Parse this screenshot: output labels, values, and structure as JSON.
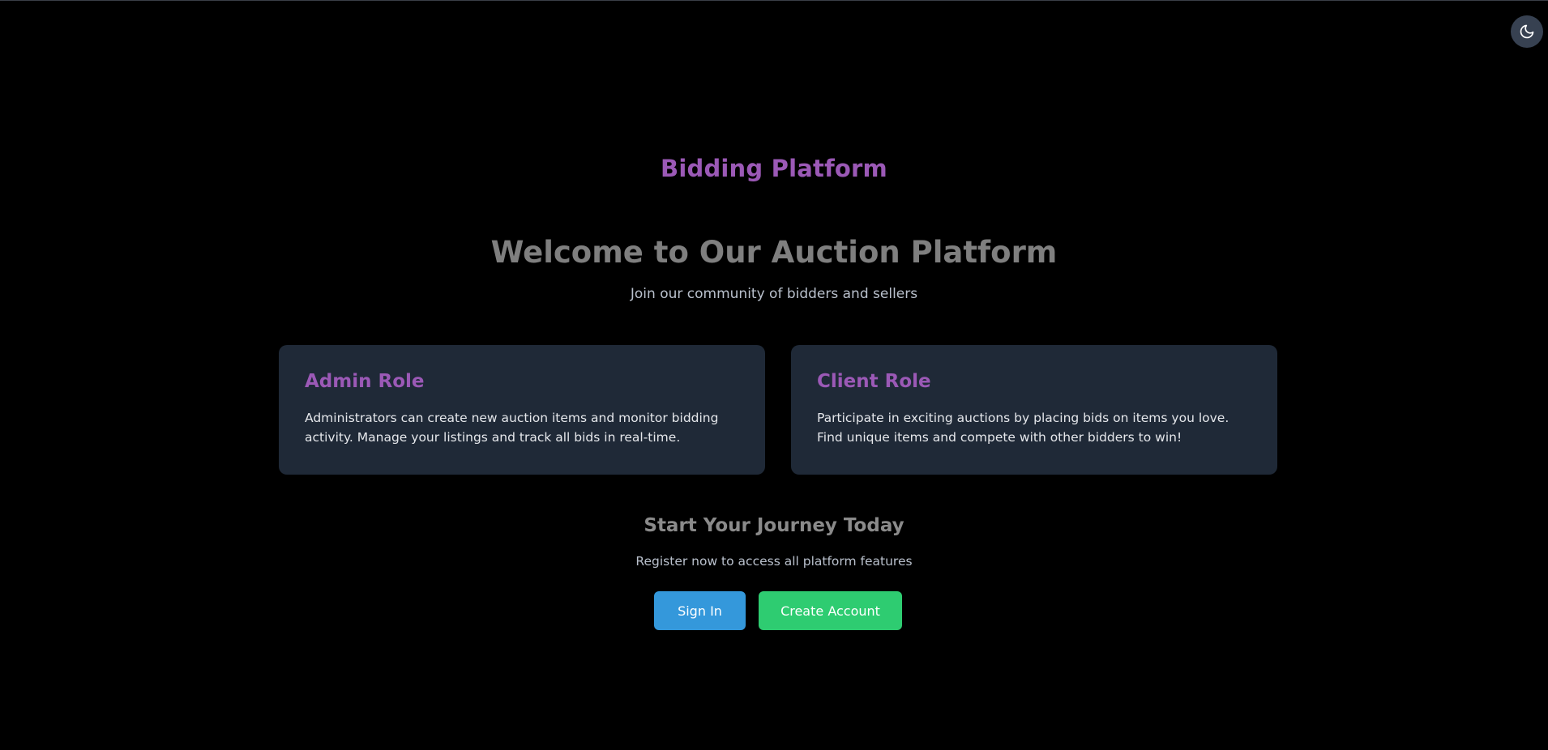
{
  "brand": {
    "title": "Bidding Platform"
  },
  "hero": {
    "title": "Welcome to Our Auction Platform",
    "subtitle": "Join our community of bidders and sellers"
  },
  "roles": [
    {
      "title": "Admin Role",
      "description": "Administrators can create new auction items and monitor bidding activity. Manage your listings and track all bids in real-time."
    },
    {
      "title": "Client Role",
      "description": "Participate in exciting auctions by placing bids on items you love. Find unique items and compete with other bidders to win!"
    }
  ],
  "cta": {
    "title": "Start Your Journey Today",
    "subtitle": "Register now to access all platform features",
    "signin_label": "Sign In",
    "create_label": "Create Account"
  },
  "theme_toggle": {
    "icon": "moon-icon"
  },
  "colors": {
    "background": "#000000",
    "accent_purple": "#9b59b6",
    "card_bg": "#1f2937",
    "signin_blue": "#3498db",
    "create_green": "#2ecc71"
  }
}
